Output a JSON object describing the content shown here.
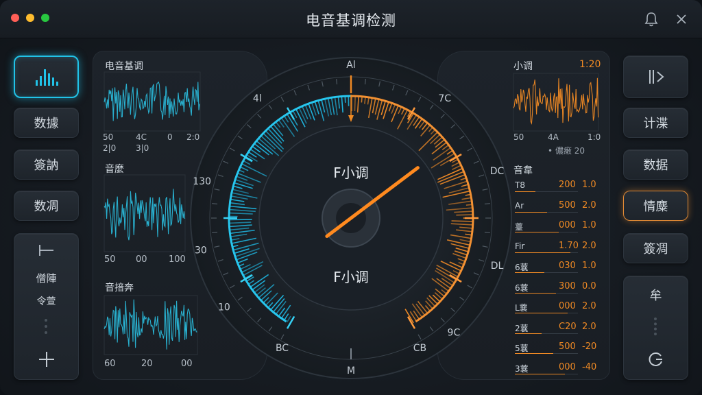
{
  "app": {
    "title": "电音基调检测"
  },
  "left_nav": {
    "top_icon": "waveform-bars-icon",
    "items": [
      "数據",
      "簽訥",
      "数凋"
    ],
    "tool_panel": {
      "top_icon": "minus-bar-icon",
      "label1": "僧陣",
      "label2": "令萱",
      "bottom_icon": "plus-icon"
    }
  },
  "waveforms_left": [
    {
      "title": "电音基调",
      "ticks": [
        "50",
        "4C",
        "0",
        "2:0"
      ],
      "sub": [
        "2|0",
        "3|0"
      ]
    },
    {
      "title": "音麼",
      "ticks": [
        "50",
        "00",
        "100"
      ]
    },
    {
      "title": "音揞奔",
      "ticks": [
        "60",
        "20",
        "00"
      ]
    }
  ],
  "dial": {
    "key_top": "F小调",
    "key_bottom": "F小调",
    "ticks": [
      "Al",
      "7C",
      "DC",
      "DL",
      "9C",
      "CB",
      "M",
      "BC",
      "10",
      "30",
      "130",
      "4l"
    ]
  },
  "right_panel": {
    "wave": {
      "title": "小调",
      "value": "1:20",
      "ticks": [
        "50",
        "4A",
        "1:0"
      ],
      "legend": "• 儂瘷 20"
    },
    "table_title": "音韋",
    "rows": [
      {
        "label": "T8",
        "value": "200",
        "extra": "1.0"
      },
      {
        "label": "Ar",
        "value": "500",
        "extra": "2.0"
      },
      {
        "label": "薹",
        "value": "000",
        "extra": "1.0"
      },
      {
        "label": "Fir",
        "value": "1.70",
        "extra": "2.0"
      },
      {
        "label": "6蘘",
        "value": "030",
        "extra": "1.0"
      },
      {
        "label": "6蘘",
        "value": "300",
        "extra": "0.0"
      },
      {
        "label": "L蘘",
        "value": "000",
        "extra": "2.0"
      },
      {
        "label": "2蘘",
        "value": "C20",
        "extra": "2.0"
      },
      {
        "label": "5蘘",
        "value": "500",
        "extra": "-20"
      },
      {
        "label": "3蘘",
        "value": "000",
        "extra": "-40"
      }
    ]
  },
  "right_nav": {
    "top_icon": "play-split-icon",
    "items": [
      "计渫",
      "数据",
      "情麋",
      "簽凋"
    ],
    "active_index": 2,
    "tool_panel": {
      "top_label": "牟",
      "bottom_icon": "refresh-icon"
    }
  },
  "colors": {
    "cyan": "#21c3e8",
    "orange": "#f08a24",
    "red": "#ff5f57",
    "yellow": "#febc2e",
    "green": "#28c840"
  },
  "meter": {
    "needle_fraction": 0.78
  }
}
